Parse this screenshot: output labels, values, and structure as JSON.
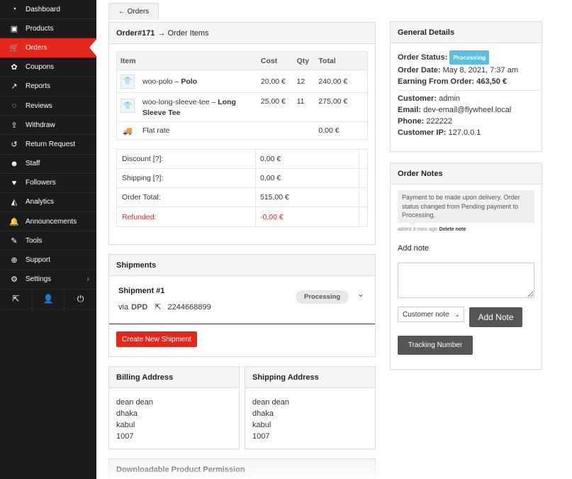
{
  "sidebar": {
    "items": [
      {
        "label": "Dashboard",
        "icon": "dashboard-icon",
        "glyph": "◔"
      },
      {
        "label": "Products",
        "icon": "briefcase-icon",
        "glyph": "▣"
      },
      {
        "label": "Orders",
        "icon": "cart-icon",
        "glyph": "🛒"
      },
      {
        "label": "Coupons",
        "icon": "gift-icon",
        "glyph": "✿"
      },
      {
        "label": "Reports",
        "icon": "line-chart-icon",
        "glyph": "↗"
      },
      {
        "label": "Reviews",
        "icon": "comments-icon",
        "glyph": "◌"
      },
      {
        "label": "Withdraw",
        "icon": "upload-icon",
        "glyph": "⇪"
      },
      {
        "label": "Return Request",
        "icon": "undo-icon",
        "glyph": "↺"
      },
      {
        "label": "Staff",
        "icon": "users-icon",
        "glyph": "☻"
      },
      {
        "label": "Followers",
        "icon": "heart-icon",
        "glyph": "♥"
      },
      {
        "label": "Analytics",
        "icon": "area-chart-icon",
        "glyph": "◭"
      },
      {
        "label": "Announcements",
        "icon": "bell-icon",
        "glyph": "🔔"
      },
      {
        "label": "Tools",
        "icon": "wrench-icon",
        "glyph": "✎"
      },
      {
        "label": "Support",
        "icon": "lifebuoy-icon",
        "glyph": "⊕"
      },
      {
        "label": "Settings",
        "icon": "gear-icon",
        "glyph": "⚙"
      }
    ],
    "active": "Orders",
    "settings_chevron": "›",
    "bottom": {
      "external": "⇱",
      "user": "👤",
      "power": "⏻"
    }
  },
  "back_button": "← Orders",
  "order_items": {
    "title": "Order#171",
    "subtitle": "→ Order Items",
    "columns": {
      "item": "Item",
      "cost": "Cost",
      "qty": "Qty",
      "total": "Total"
    },
    "rows": [
      {
        "sku": "woo-polo",
        "sep": " – ",
        "name": "Polo",
        "cost": "20,00 €",
        "qty": "12",
        "total": "240,00 €"
      },
      {
        "sku": "woo-long-sleeve-tee",
        "sep": " – ",
        "name": "Long",
        "name2": "Sleeve Tee",
        "cost": "25,00 €",
        "qty": "11",
        "total": "275,00 €"
      }
    ],
    "shipping_row": {
      "label": "Flat rate",
      "total": "0,00 €"
    },
    "totals": [
      {
        "label": "Discount [?]:",
        "value": "0,00 €"
      },
      {
        "label": "Shipping [?]:",
        "value": "0,00 €"
      },
      {
        "label": "Order Total:",
        "value": "515,00 €"
      },
      {
        "label": "Refunded:",
        "value": "-0,00 €"
      }
    ]
  },
  "shipments": {
    "title": "Shipments",
    "shipment_title": "Shipment #1",
    "via": "via",
    "carrier": "DPD",
    "tracking": "2244668899",
    "status": "Processing",
    "create_button": "Create New Shipment"
  },
  "billing": {
    "title": "Billing Address",
    "lines": [
      "dean dean",
      "dhaka",
      "kabul",
      "1007"
    ]
  },
  "shipping": {
    "title": "Shipping Address",
    "lines": [
      "dean dean",
      "dhaka",
      "kabul",
      "1007"
    ]
  },
  "downloadable": {
    "title": "Downloadable Product Permission"
  },
  "general": {
    "title": "General Details",
    "status_label": "Order Status:",
    "status": "Processing",
    "date_label": "Order Date:",
    "date": "May 8, 2021, 7:37 am",
    "earning_label": "Earning From Order:",
    "earning": "463,50 €",
    "customer_label": "Customer:",
    "customer": "admin",
    "email_label": "Email:",
    "email": "dev-email@flywheel.local",
    "phone_label": "Phone:",
    "phone": "222222",
    "ip_label": "Customer IP:",
    "ip": "127.0.0.1"
  },
  "notes": {
    "title": "Order Notes",
    "note_text": "Payment to be made upon delivery. Order status changed from Pending payment to Processing.",
    "note_meta": "added 3 mins ago",
    "delete_label": "Delete note",
    "add_note_label": "Add note",
    "note_type": "Customer note",
    "add_button": "Add Note",
    "tracking_button": "Tracking Number"
  },
  "colors": {
    "accent": "#e3271c",
    "sidebar": "#1b1b1b",
    "badge": "#5bc0de"
  }
}
